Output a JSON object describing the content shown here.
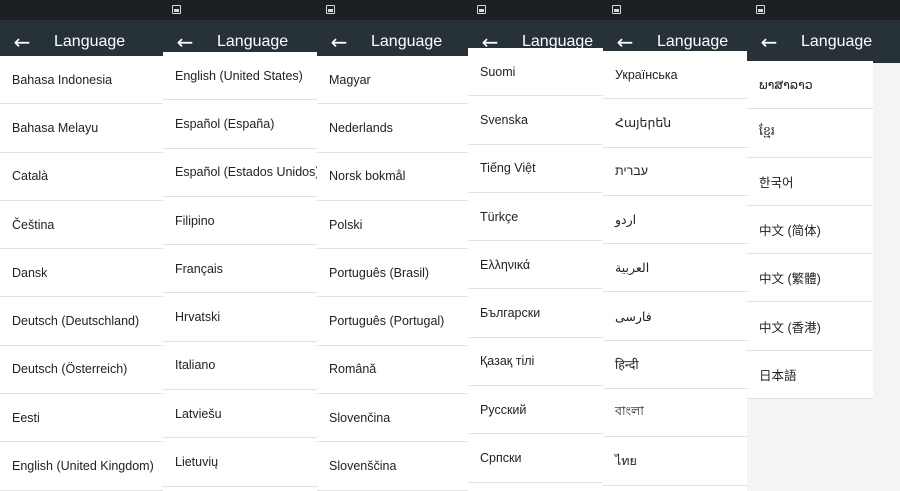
{
  "app": {
    "back_glyph": "←",
    "title": "Language"
  },
  "panels": [
    {
      "items": [
        "Bahasa Indonesia",
        "Bahasa Melayu",
        "Català",
        "Čeština",
        "Dansk",
        "Deutsch (Deutschland)",
        "Deutsch (Österreich)",
        "Eesti",
        "English (United Kingdom)"
      ]
    },
    {
      "items": [
        "English (United States)",
        "Español (España)",
        "Español (Estados Unidos)",
        "Filipino",
        "Français",
        "Hrvatski",
        "Italiano",
        "Latviešu",
        "Lietuvių"
      ]
    },
    {
      "items": [
        "Magyar",
        "Nederlands",
        "Norsk bokmål",
        "Polski",
        "Português (Brasil)",
        "Português (Portugal)",
        "Română",
        "Slovenčina",
        "Slovenščina"
      ]
    },
    {
      "items": [
        "Suomi",
        "Svenska",
        "Tiếng Việt",
        "Türkçe",
        "Ελληνικά",
        "Български",
        "Қазақ тілі",
        "Русский",
        "Српски"
      ]
    },
    {
      "items": [
        "Українська",
        "Հայերեն",
        "עברית",
        "اردو",
        "العربية",
        "فارسی",
        "हिन्दी",
        "বাংলা",
        "ไทย"
      ]
    },
    {
      "items": [
        "ພາສາລາວ",
        "ខ្មែរ",
        "한국어",
        "中文 (简体)",
        "中文 (繁體)",
        "中文 (香港)",
        "日本語"
      ]
    }
  ],
  "icons": {
    "notification": "picture-notification-icon",
    "back": "back-arrow-icon"
  },
  "colors": {
    "status_bar": "#1d2022",
    "app_bar": "#263238",
    "divider": "#e2e2e2",
    "text": "#222222"
  }
}
